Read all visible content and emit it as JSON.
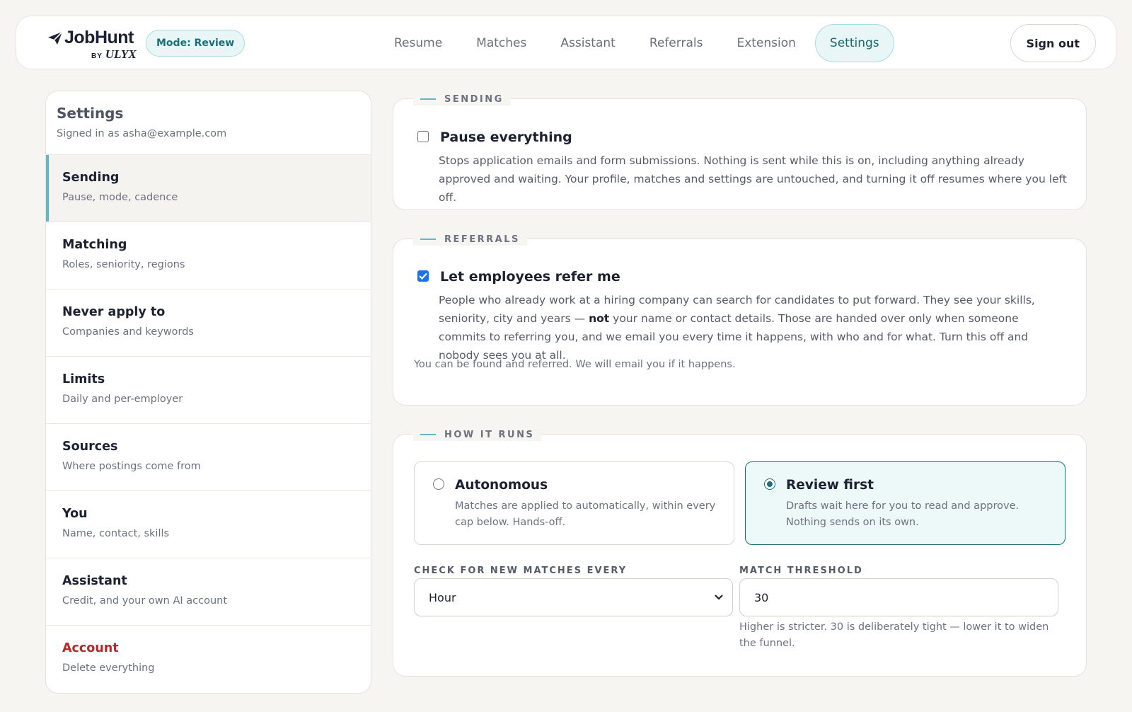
{
  "header": {
    "logo_text": "JobHunt",
    "logo_by": "BY",
    "logo_brand": "ULYX",
    "mode_badge": "Mode: Review",
    "tabs": [
      {
        "label": "Resume"
      },
      {
        "label": "Matches"
      },
      {
        "label": "Assistant"
      },
      {
        "label": "Referrals"
      },
      {
        "label": "Extension"
      },
      {
        "label": "Settings",
        "active": true
      }
    ],
    "sign_out": "Sign out"
  },
  "sidebar": {
    "title": "Settings",
    "subtitle": "Signed in as asha@example.com",
    "items": [
      {
        "label": "Sending",
        "desc": "Pause, mode, cadence",
        "active": true
      },
      {
        "label": "Matching",
        "desc": "Roles, seniority, regions"
      },
      {
        "label": "Never apply to",
        "desc": "Companies and keywords"
      },
      {
        "label": "Limits",
        "desc": "Daily and per-employer"
      },
      {
        "label": "Sources",
        "desc": "Where postings come from"
      },
      {
        "label": "You",
        "desc": "Name, contact, skills"
      },
      {
        "label": "Assistant",
        "desc": "Credit, and your own AI account"
      },
      {
        "label": "Account",
        "desc": "Delete everything",
        "danger": true
      }
    ]
  },
  "sending": {
    "legend": "SENDING",
    "pause_label": "Pause everything",
    "pause_checked": false,
    "pause_desc": "Stops application emails and form submissions. Nothing is sent while this is on, including anything already approved and waiting. Your profile, matches and settings are untouched, and turning it off resumes where you left off."
  },
  "referrals": {
    "legend": "REFERRALS",
    "refer_label": "Let employees refer me",
    "refer_checked": true,
    "desc_part1": "People who already work at a hiring company can search for candidates to put forward. They see your skills, seniority, city and years — ",
    "desc_bold": "not",
    "desc_part2": " your name or contact details. Those are handed over only when someone commits to referring you, and we email you every time it happens, with who and for what. Turn this off and nobody sees you at all.",
    "status_note": "You can be found and referred. We will email you if it happens."
  },
  "how_it_runs": {
    "legend": "HOW IT RUNS",
    "options": [
      {
        "title": "Autonomous",
        "desc": "Matches are applied to automatically, within every cap below. Hands-off.",
        "selected": false
      },
      {
        "title": "Review first",
        "desc": "Drafts wait here for you to read and approve. Nothing sends on its own.",
        "selected": true
      }
    ],
    "frequency_label": "CHECK FOR NEW MATCHES EVERY",
    "frequency_value": "Hour",
    "threshold_label": "MATCH THRESHOLD",
    "threshold_value": "30",
    "threshold_hint": "Higher is stricter. 30 is deliberately tight — lower it to widen the funnel."
  },
  "colors": {
    "accent": "#5fb8c2",
    "accent_dark": "#1e6f78",
    "danger": "#b3292e",
    "checkbox_blue": "#1a73e8",
    "background": "#f6f5f2"
  },
  "icons": {
    "logo": "paper-plane-icon",
    "select": "chevron-down-icon",
    "check": "checkmark-icon"
  }
}
